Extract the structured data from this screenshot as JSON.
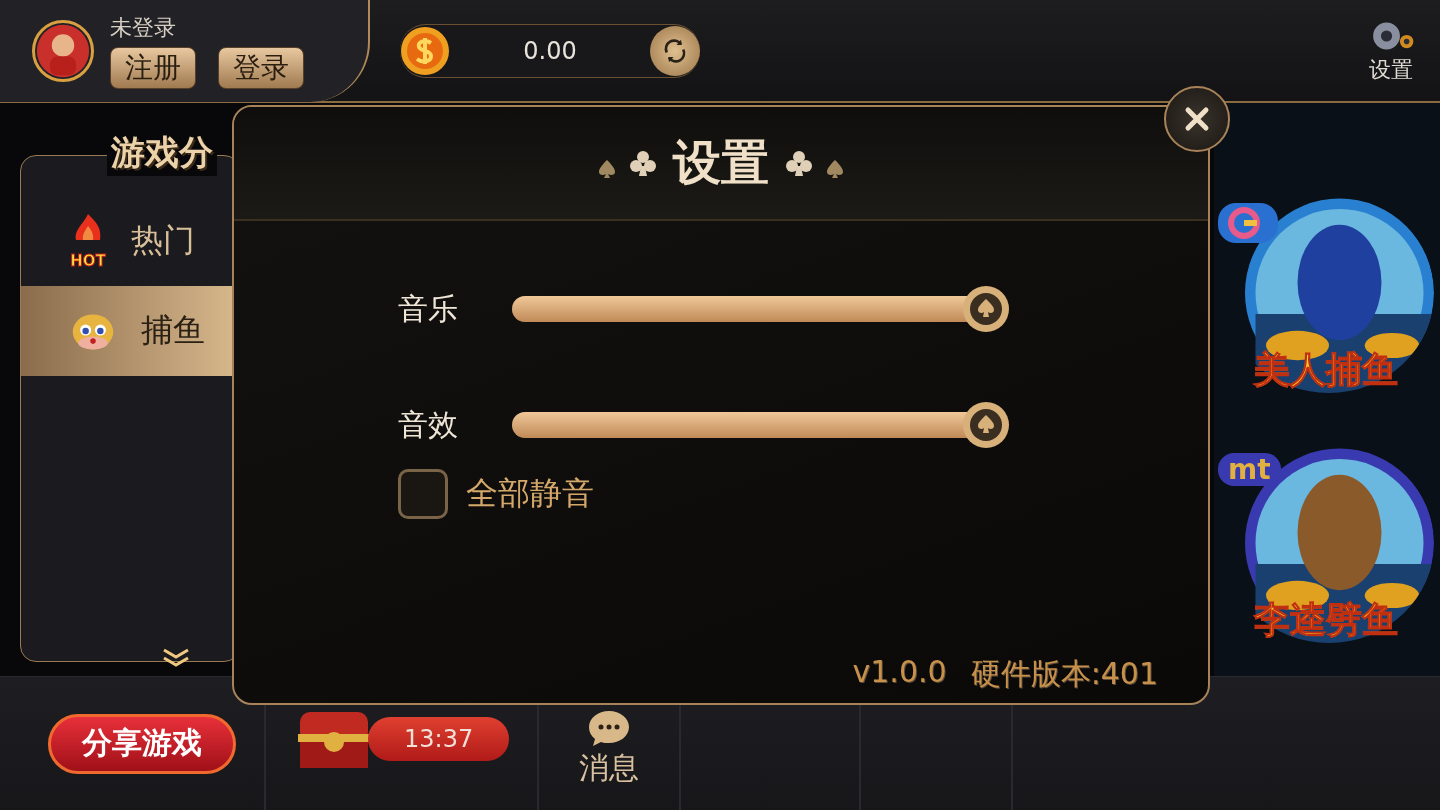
{
  "user": {
    "status": "未登录",
    "buttons": [
      "注册",
      "登录"
    ]
  },
  "balance": {
    "amount": "0.00"
  },
  "settings_button": {
    "label": "设置"
  },
  "category_panel": {
    "title": "游戏分",
    "items": [
      {
        "label": "热门",
        "kind": "hot",
        "badge": "HOT",
        "selected": false
      },
      {
        "label": "捕鱼",
        "kind": "fish",
        "selected": true
      }
    ]
  },
  "dialog": {
    "title": "设置",
    "sliders": [
      {
        "label": "音乐",
        "level": 1
      },
      {
        "label": "音效",
        "level": 1
      }
    ],
    "mute_all": {
      "label": "全部静音",
      "checked": false
    },
    "version": "v1.0.0",
    "hardware_version": "硬件版本:401"
  },
  "games": [
    {
      "title": "美人捕鱼"
    },
    {
      "title": "李逵劈鱼",
      "badge": "mt"
    }
  ],
  "bottom_bar": {
    "share": "分享游戏",
    "timer": "13:37",
    "messages": "消息"
  }
}
